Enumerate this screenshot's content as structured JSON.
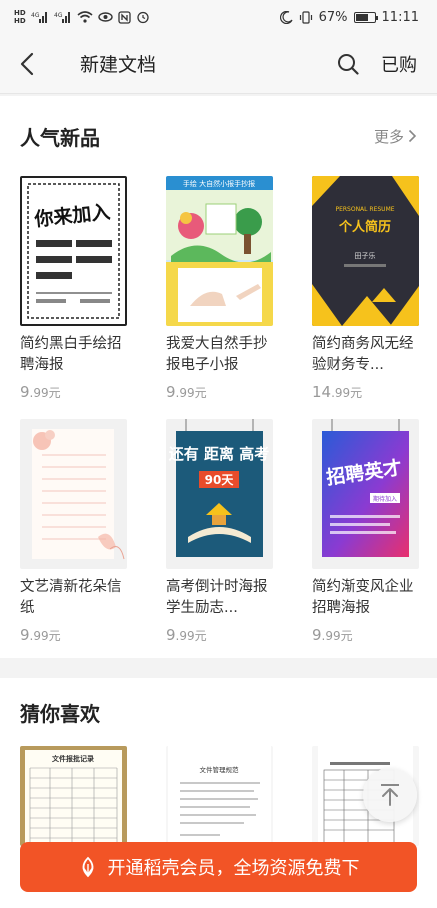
{
  "status_bar": {
    "hd1": "HD",
    "hd2": "HD",
    "net1": "4G",
    "net2": "4G",
    "battery_text": "67%",
    "battery_level": 0.67,
    "time": "11:11"
  },
  "header": {
    "title": "新建文档",
    "purchased_label": "已购"
  },
  "popular": {
    "title": "人气新品",
    "more_label": "更多",
    "items": [
      {
        "title": "简约黑白手绘招聘海报",
        "price_int": "9",
        "price_dec": ".99元"
      },
      {
        "title": "我爱大自然手抄报电子小报",
        "price_int": "9",
        "price_dec": ".99元"
      },
      {
        "title": "简约商务风无经验财务专...",
        "price_int": "14",
        "price_dec": ".99元"
      },
      {
        "title": "文艺清新花朵信纸",
        "price_int": "9",
        "price_dec": ".99元"
      },
      {
        "title": "高考倒计时海报学生励志...",
        "price_int": "9",
        "price_dec": ".99元"
      },
      {
        "title": "简约渐变风企业招聘海报",
        "price_int": "9",
        "price_dec": ".99元"
      }
    ],
    "thumb_texts": {
      "hire_black": "你来加入",
      "nature_banner": "手绘 大自然小报手抄报",
      "resume_title": "个人简历",
      "resume_sub": "PERSONAL RESUME",
      "resume_name": "田子乐",
      "exam_main": "还有 距离 高考",
      "exam_days": "90天",
      "gradient_title": "招聘英才",
      "gradient_sub": "期待加入"
    }
  },
  "guess": {
    "title": "猜你喜欢",
    "thumb_texts": {
      "report": "文件报批记录",
      "rules": "文件管理规范"
    }
  },
  "vip": {
    "label": "开通稻壳会员，全场资源免费下"
  }
}
